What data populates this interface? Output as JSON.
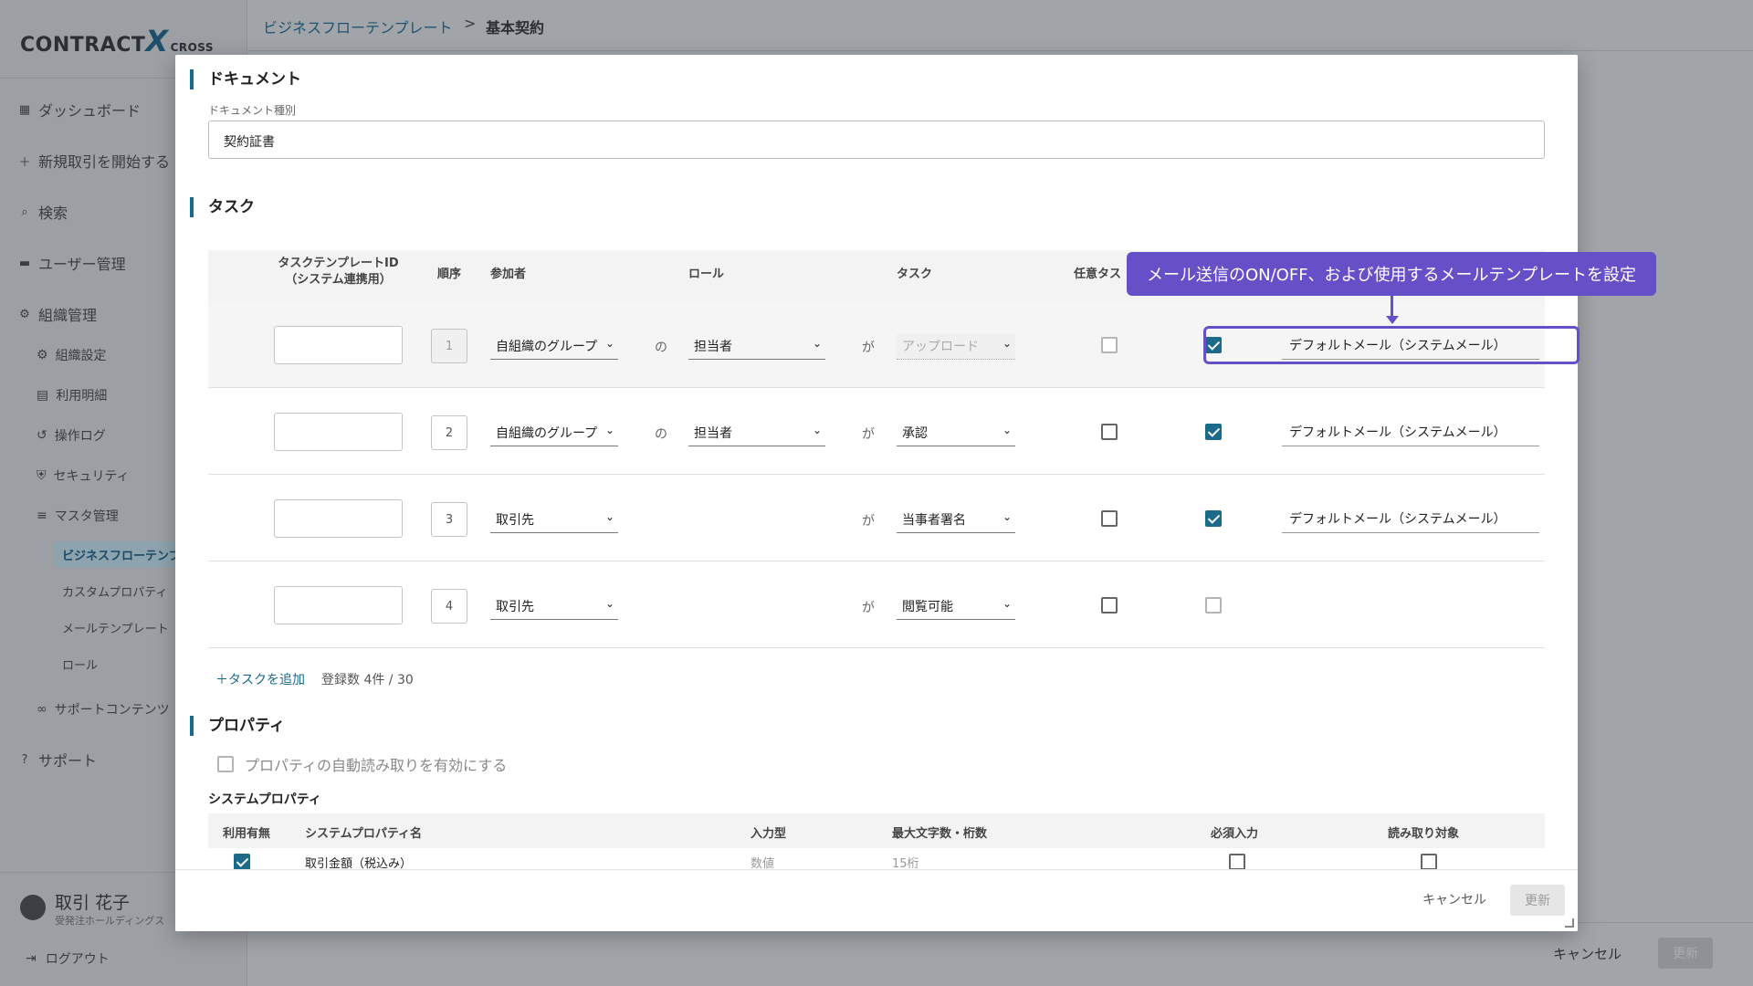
{
  "app": {
    "logo_main": "CONTRACT",
    "logo_x": "X",
    "logo_sub": "CROSS"
  },
  "sidebar": {
    "items": [
      {
        "label": "ダッシュボード",
        "icon": "dashboard-icon"
      },
      {
        "label": "新規取引を開始する",
        "icon": "plus-icon"
      },
      {
        "label": "検索",
        "icon": "search-icon"
      },
      {
        "label": "ユーザー管理",
        "icon": "users-icon"
      },
      {
        "label": "組織管理",
        "icon": "gear-icon"
      }
    ],
    "org_sub": [
      {
        "label": "組織設定",
        "icon": "gear-icon"
      },
      {
        "label": "利用明細",
        "icon": "billing-icon"
      },
      {
        "label": "操作ログ",
        "icon": "history-icon"
      },
      {
        "label": "セキュリティ",
        "icon": "shield-icon"
      },
      {
        "label": "マスタ管理",
        "icon": "database-icon"
      }
    ],
    "master_sub": [
      {
        "label": "ビジネスフローテンプレ"
      },
      {
        "label": "カスタムプロパティ"
      },
      {
        "label": "メールテンプレート"
      },
      {
        "label": "ロール"
      }
    ],
    "support_contents": "サポートコンテンツ",
    "support": "サポート",
    "user_name": "取引 花子",
    "user_org": "受発注ホールディングス",
    "logout": "ログアウト"
  },
  "breadcrumb": {
    "parent": "ビジネスフローテンプレート",
    "separator": ">",
    "current": "基本契約"
  },
  "background_footer": {
    "cancel": "キャンセル",
    "update": "更新"
  },
  "modal": {
    "document_section": "ドキュメント",
    "document_type_label": "ドキュメント種別",
    "document_type_value": "契約証書",
    "task_section": "タスク",
    "task_headers": {
      "template_id": "タスクテンプレートID",
      "template_id_sub": "（システム連携用）",
      "order": "順序",
      "participant": "参加者",
      "role": "ロール",
      "task": "タスク",
      "optional": "任意タス"
    },
    "particle_no": "の",
    "particle_ga": "が",
    "tasks": [
      {
        "order": "1",
        "participant": "自組織のグループ",
        "role": "担当者",
        "task": "アップロード",
        "optional": false,
        "mail": true,
        "mail_template": "デフォルトメール（システムメール）"
      },
      {
        "order": "2",
        "participant": "自組織のグループ",
        "role": "担当者",
        "task": "承認",
        "optional": false,
        "mail": true,
        "mail_template": "デフォルトメール（システムメール）"
      },
      {
        "order": "3",
        "participant": "取引先",
        "role": "",
        "task": "当事者署名",
        "optional": false,
        "mail": true,
        "mail_template": "デフォルトメール（システムメール）"
      },
      {
        "order": "4",
        "participant": "取引先",
        "role": "",
        "task": "閲覧可能",
        "optional": false,
        "mail": false,
        "mail_template": ""
      }
    ],
    "add_task": "＋タスクを追加",
    "register_count": "登録数 4件 / 30",
    "property_section": "プロパティ",
    "auto_read_label": "プロパティの自動読み取りを有効にする",
    "system_property_title": "システムプロパティ",
    "property_headers": {
      "enabled": "利用有無",
      "name": "システムプロパティ名",
      "input_type": "入力型",
      "max_len": "最大文字数・桁数",
      "required": "必須入力",
      "read_target": "読み取り対象"
    },
    "property_rows": [
      {
        "name": "取引金額（税込み）",
        "input_type": "数値",
        "max_len": "15桁"
      }
    ],
    "cancel": "キャンセル",
    "update": "更新"
  },
  "callout": {
    "text": "メール送信のON/OFF、および使用するメールテンプレートを設定"
  }
}
